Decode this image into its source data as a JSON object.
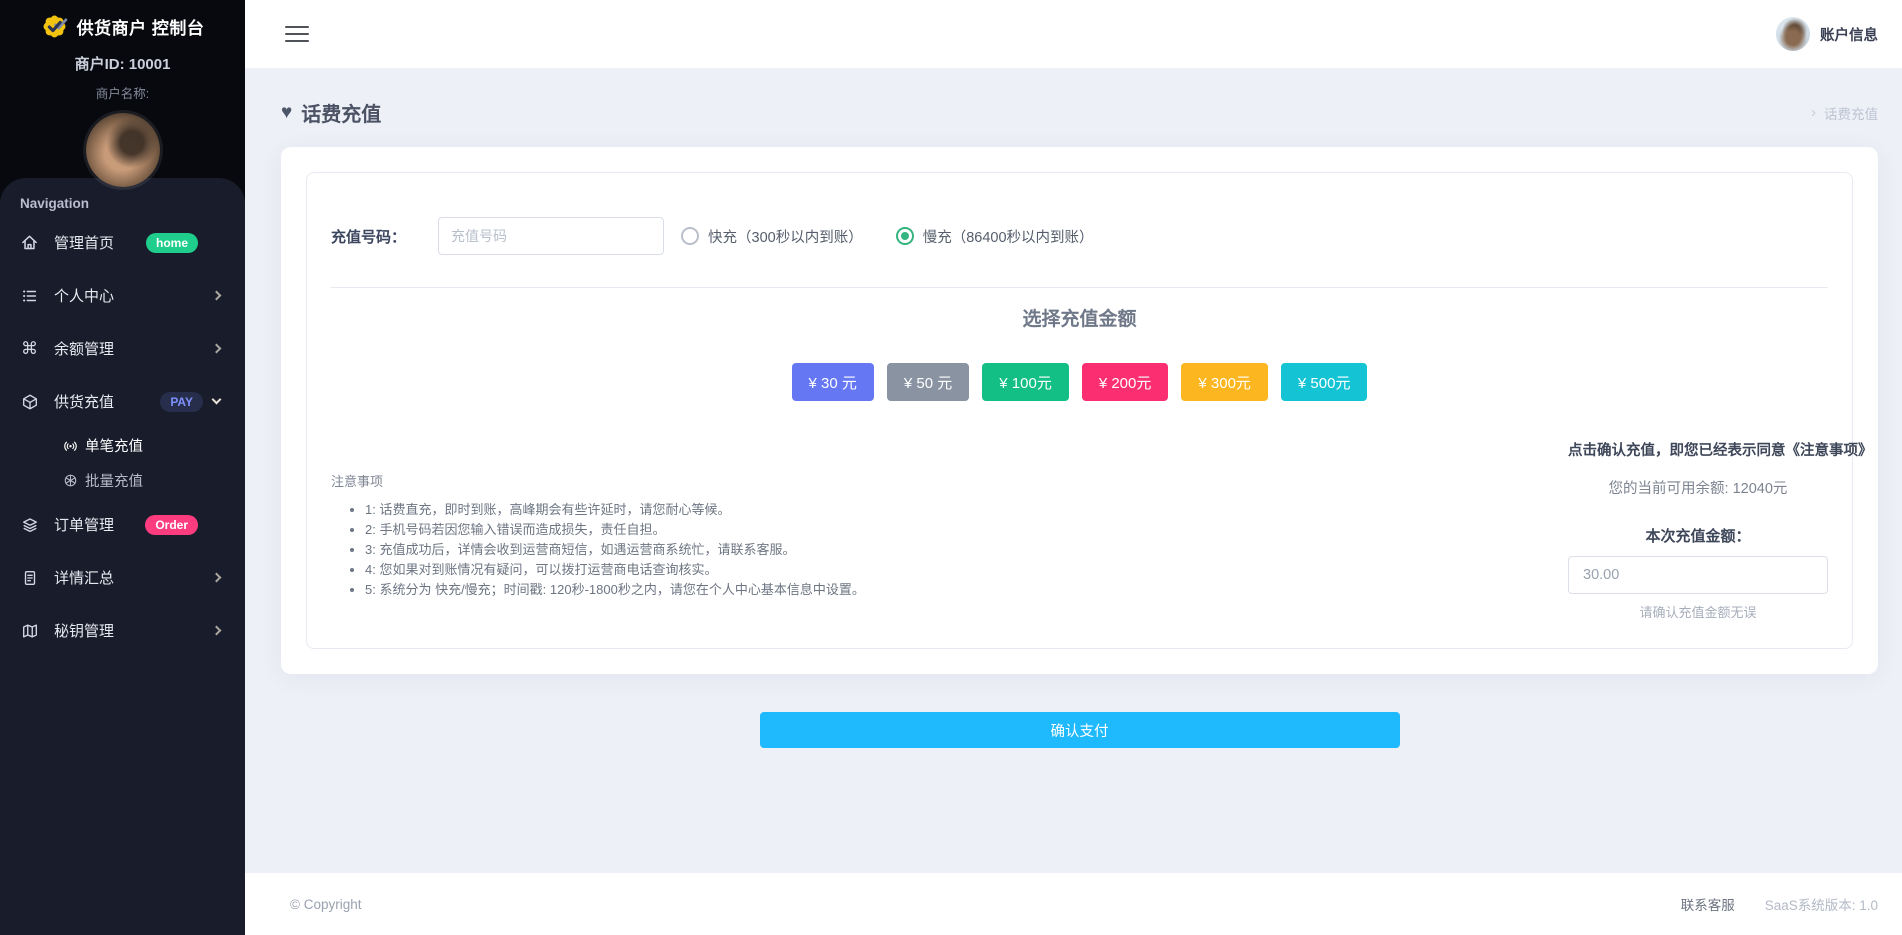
{
  "sidebar": {
    "brand_title": "供货商户 控制台",
    "merchant_id": "商户ID: 10001",
    "merchant_name": "商户名称:",
    "nav_heading": "Navigation",
    "items": [
      {
        "label": "管理首页",
        "badge": "home"
      },
      {
        "label": "个人中心"
      },
      {
        "label": "余额管理"
      },
      {
        "label": "供货充值",
        "badge": "PAY"
      },
      {
        "label": "订单管理",
        "badge": "Order"
      },
      {
        "label": "详情汇总"
      },
      {
        "label": "秘钥管理"
      }
    ],
    "subitems": [
      {
        "label": "单笔充值"
      },
      {
        "label": "批量充值"
      }
    ]
  },
  "topbar": {
    "account_label": "账户信息"
  },
  "page": {
    "title": "话费充值",
    "breadcrumb": "话费充值"
  },
  "form": {
    "number_label": "充值号码：",
    "number_placeholder": "充值号码",
    "radio_fast": "快充（300秒以内到账）",
    "radio_slow": "慢充（86400秒以内到账）",
    "amount_heading": "选择充值金额",
    "amounts": [
      {
        "label": "¥ 30 元",
        "color": "#6577f3"
      },
      {
        "label": "¥ 50 元",
        "color": "#8a93a2"
      },
      {
        "label": "¥ 100元",
        "color": "#13bf85"
      },
      {
        "label": "¥ 200元",
        "color": "#fb2e71"
      },
      {
        "label": "¥ 300元",
        "color": "#fcb61f"
      },
      {
        "label": "¥ 500元",
        "color": "#14c4d4"
      }
    ],
    "agree_text": "点击确认充值，即您已经表示同意《注意事项》",
    "balance_text": "您的当前可用余额: 12040元",
    "amount_label": "本次充值金额：",
    "amount_value": "30.00",
    "amount_hint": "请确认充值金额无误",
    "notes_title": "注意事项",
    "notes": [
      "1: 话费直充，即时到账，高峰期会有些许延时，请您耐心等候。",
      "2: 手机号码若因您输入错误而造成损失，责任自担。",
      "3: 充值成功后，详情会收到运营商短信，如遇运营商系统忙，请联系客服。",
      "4: 您如果对到账情况有疑问，可以拨打运营商电话查询核实。",
      "5: 系统分为 快充/慢充；时间戳: 120秒-1800秒之内，请您在个人中心基本信息中设置。"
    ],
    "confirm_label": "确认支付"
  },
  "footer": {
    "copyright": "© Copyright",
    "support": "联系客服",
    "version": "SaaS系统版本: 1.0"
  },
  "colors": {
    "home_badge": "#1fce8c",
    "pay_badge_bg": "#272e4b",
    "pay_badge_text": "#7e90fa",
    "order_badge": "#fd3c7f",
    "confirm_button": "#1fb9fd"
  }
}
